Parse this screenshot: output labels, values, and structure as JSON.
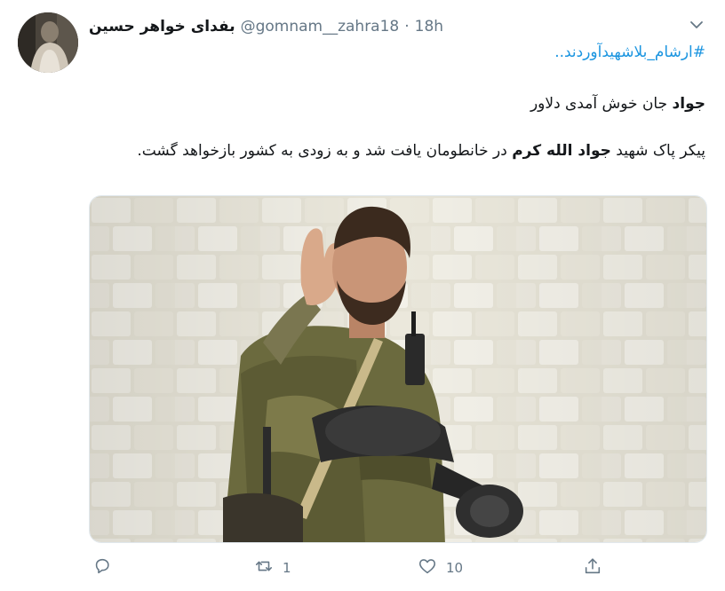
{
  "tweet": {
    "display_name": "بفدای خواهر حسین",
    "handle": "@gomnam__zahra18",
    "separator": "·",
    "time": "18h",
    "hashtag": "#ارشام_بلاشهیدآوردند..",
    "greeting_bold": "جواد",
    "greeting_rest": " جان خوش آمدی دلاور",
    "body_part1": "پیکر پاک شهید ",
    "body_bold": "جواد الله کرم",
    "body_part2": " در خانطومان یافت شد و به زودی به کشور بازخواهد گشت.",
    "retweet_count": "1",
    "like_count": "10"
  },
  "icons": {
    "menu": "chevron-down-icon",
    "reply": "reply-icon",
    "retweet": "retweet-icon",
    "like": "heart-icon",
    "share": "share-icon"
  },
  "colors": {
    "link": "#1b95e0",
    "secondary_text": "#657786",
    "primary_text": "#14171a",
    "border": "#e1e8ed"
  }
}
